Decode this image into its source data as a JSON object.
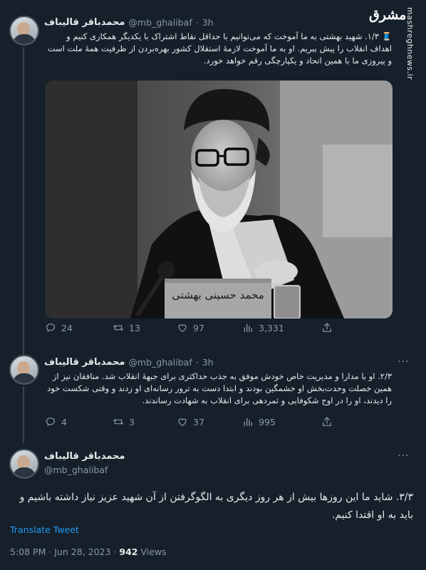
{
  "watermark": {
    "logo_text": "مشرق",
    "site": "mashreghnews.ir"
  },
  "tweets": [
    {
      "name": "محمدباقر قالیباف",
      "handle": "@mb_ghalibaf",
      "time": "3h",
      "text": "‏🧵 ۱/۳. شهید بهشتی به ما آموخت که می‌توانیم با حداقل نقاط اشتراک با یکدیگر همکاری کنیم و اهداف انقلاب را پیش ببریم. او به ما آموخت لازمهٔ استقلال کشور بهره‌بردن از ظرفیت همهٔ ملت است و پیروزی ما با همین اتحاد و یکپارچگی رقم خواهد خورد.",
      "photo": {
        "nameplate": "محمد حسینی بهشتی"
      },
      "stats": {
        "replies": "24",
        "retweets": "13",
        "likes": "97",
        "views": "3,331"
      }
    },
    {
      "name": "محمدباقر قالیباف",
      "handle": "@mb_ghalibaf",
      "time": "3h",
      "text": "۲/۳. او با مدارا و مدیریت خاص خودش موفق به جذب حداکثری برای جبههٔ انقلاب شد. منافقان نیز از همین خصلت وحدت‌بخش او خشمگین بودند و ابتدا دست به ترور رسانه‌ای او زدند و وقتی شکست خود را دیدند، او را در اوج شکوفایی و ثمردهی برای انقلاب به شهادت رساندند.",
      "stats": {
        "replies": "4",
        "retweets": "3",
        "likes": "37",
        "views": "995"
      }
    }
  ],
  "main_tweet": {
    "name": "محمدباقر قالیباف",
    "handle": "@mb_ghalibaf",
    "text": "۳/۳. شاید ما این روزها بیش از هر روز دیگری به الگوگرفتن از آن شهید عزیز نیاز داشته باشیم و باید به او اقتدا کنیم.",
    "translate": "Translate Tweet",
    "timestamp": "5:08 PM · Jun 28, 2023 · ",
    "views_count": "942",
    "views_label": " Views"
  },
  "more_glyph": "···"
}
